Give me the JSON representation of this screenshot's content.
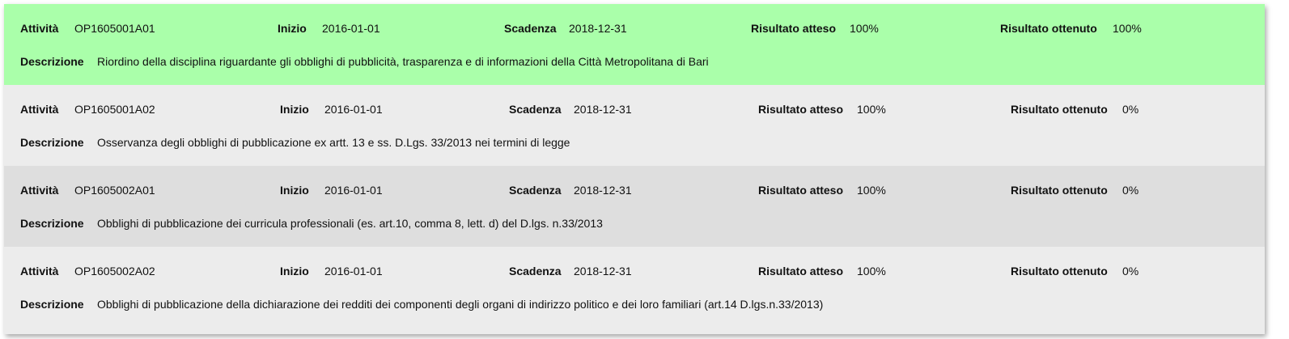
{
  "labels": {
    "attivita": "Attività",
    "inizio": "Inizio",
    "scadenza": "Scadenza",
    "risultato_atteso": "Risultato atteso",
    "risultato_ottenuto": "Risultato ottenuto",
    "descrizione": "Descrizione"
  },
  "colors": {
    "completed_row": "#aaffaa",
    "row_light": "#ececec",
    "row_dark": "#dedede"
  },
  "rows": [
    {
      "attivita": "OP1605001A01",
      "inizio": "2016-01-01",
      "scadenza": "2018-12-31",
      "risultato_atteso": "100%",
      "risultato_ottenuto": "100%",
      "descrizione": "Riordino della disciplina riguardante gli obblighi di pubblicità, trasparenza e di informazioni della Città Metropolitana di Bari"
    },
    {
      "attivita": "OP1605001A02",
      "inizio": "2016-01-01",
      "scadenza": "2018-12-31",
      "risultato_atteso": "100%",
      "risultato_ottenuto": "0%",
      "descrizione": "Osservanza degli obblighi di pubblicazione ex artt. 13 e ss. D.Lgs. 33/2013 nei termini di legge"
    },
    {
      "attivita": "OP1605002A01",
      "inizio": "2016-01-01",
      "scadenza": "2018-12-31",
      "risultato_atteso": "100%",
      "risultato_ottenuto": "0%",
      "descrizione": "Obblighi di pubblicazione dei curricula professionali (es. art.10, comma 8, lett. d) del D.lgs. n.33/2013"
    },
    {
      "attivita": "OP1605002A02",
      "inizio": "2016-01-01",
      "scadenza": "2018-12-31",
      "risultato_atteso": "100%",
      "risultato_ottenuto": "0%",
      "descrizione": "Obblighi di pubblicazione della dichiarazione dei redditi dei componenti degli organi di indirizzo politico e dei loro familiari (art.14 D.lgs.n.33/2013)"
    }
  ]
}
